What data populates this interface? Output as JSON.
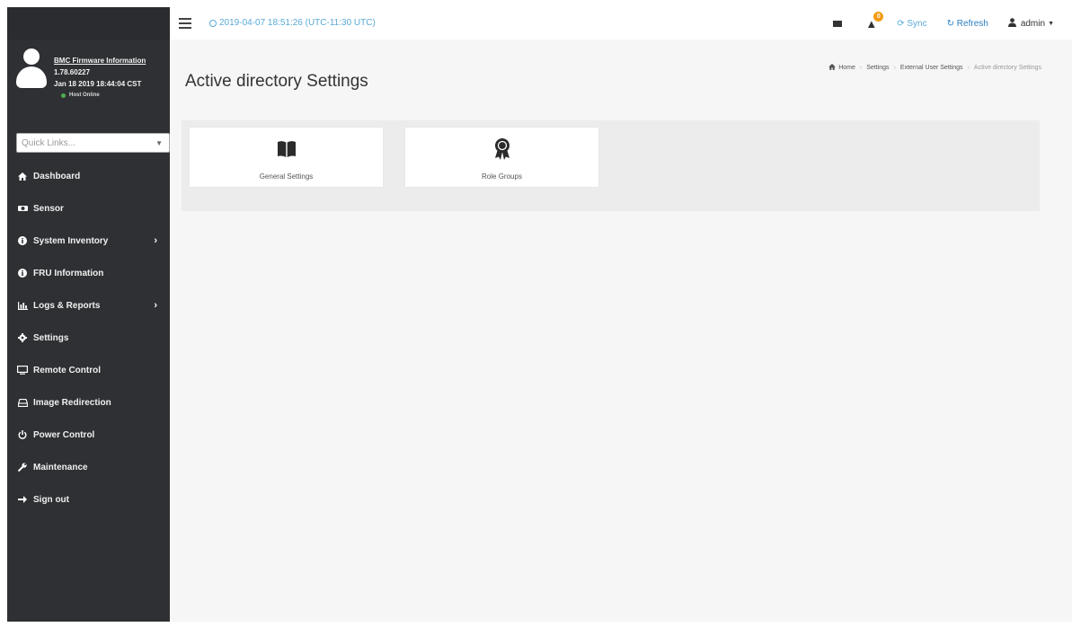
{
  "header": {
    "datetime": "2019-04-07 18:51:26 (UTC-11:30 UTC)",
    "notification_count": "0",
    "sync_label": "Sync",
    "refresh_label": "Refresh",
    "user_label": "admin",
    "accent_color": "#5aa9d6"
  },
  "sidebar": {
    "fw_title": "BMC Firmware Information",
    "fw_version": "1.78.60227",
    "fw_date": "Jan 18 2019 18:44:04 CST",
    "host_status": "Host Online",
    "quick_links_placeholder": "Quick Links...",
    "items": [
      {
        "label": "Dashboard",
        "icon": "home-icon",
        "chevron": false
      },
      {
        "label": "Sensor",
        "icon": "sensor-icon",
        "chevron": false
      },
      {
        "label": "System Inventory",
        "icon": "info-icon",
        "chevron": true
      },
      {
        "label": "FRU Information",
        "icon": "info-icon",
        "chevron": false
      },
      {
        "label": "Logs & Reports",
        "icon": "chart-icon",
        "chevron": true
      },
      {
        "label": "Settings",
        "icon": "gear-icon",
        "chevron": false
      },
      {
        "label": "Remote Control",
        "icon": "monitor-icon",
        "chevron": false
      },
      {
        "label": "Image Redirection",
        "icon": "disk-icon",
        "chevron": false
      },
      {
        "label": "Power Control",
        "icon": "power-icon",
        "chevron": false
      },
      {
        "label": "Maintenance",
        "icon": "wrench-icon",
        "chevron": false
      },
      {
        "label": "Sign out",
        "icon": "sign-out-icon",
        "chevron": false
      }
    ]
  },
  "main": {
    "title": "Active directory Settings",
    "breadcrumb": [
      "Home",
      "Settings",
      "External User Settings",
      "Active directory Settings"
    ],
    "tiles": [
      {
        "label": "General Settings",
        "icon": "book-icon"
      },
      {
        "label": "Role Groups",
        "icon": "award-icon"
      }
    ]
  }
}
